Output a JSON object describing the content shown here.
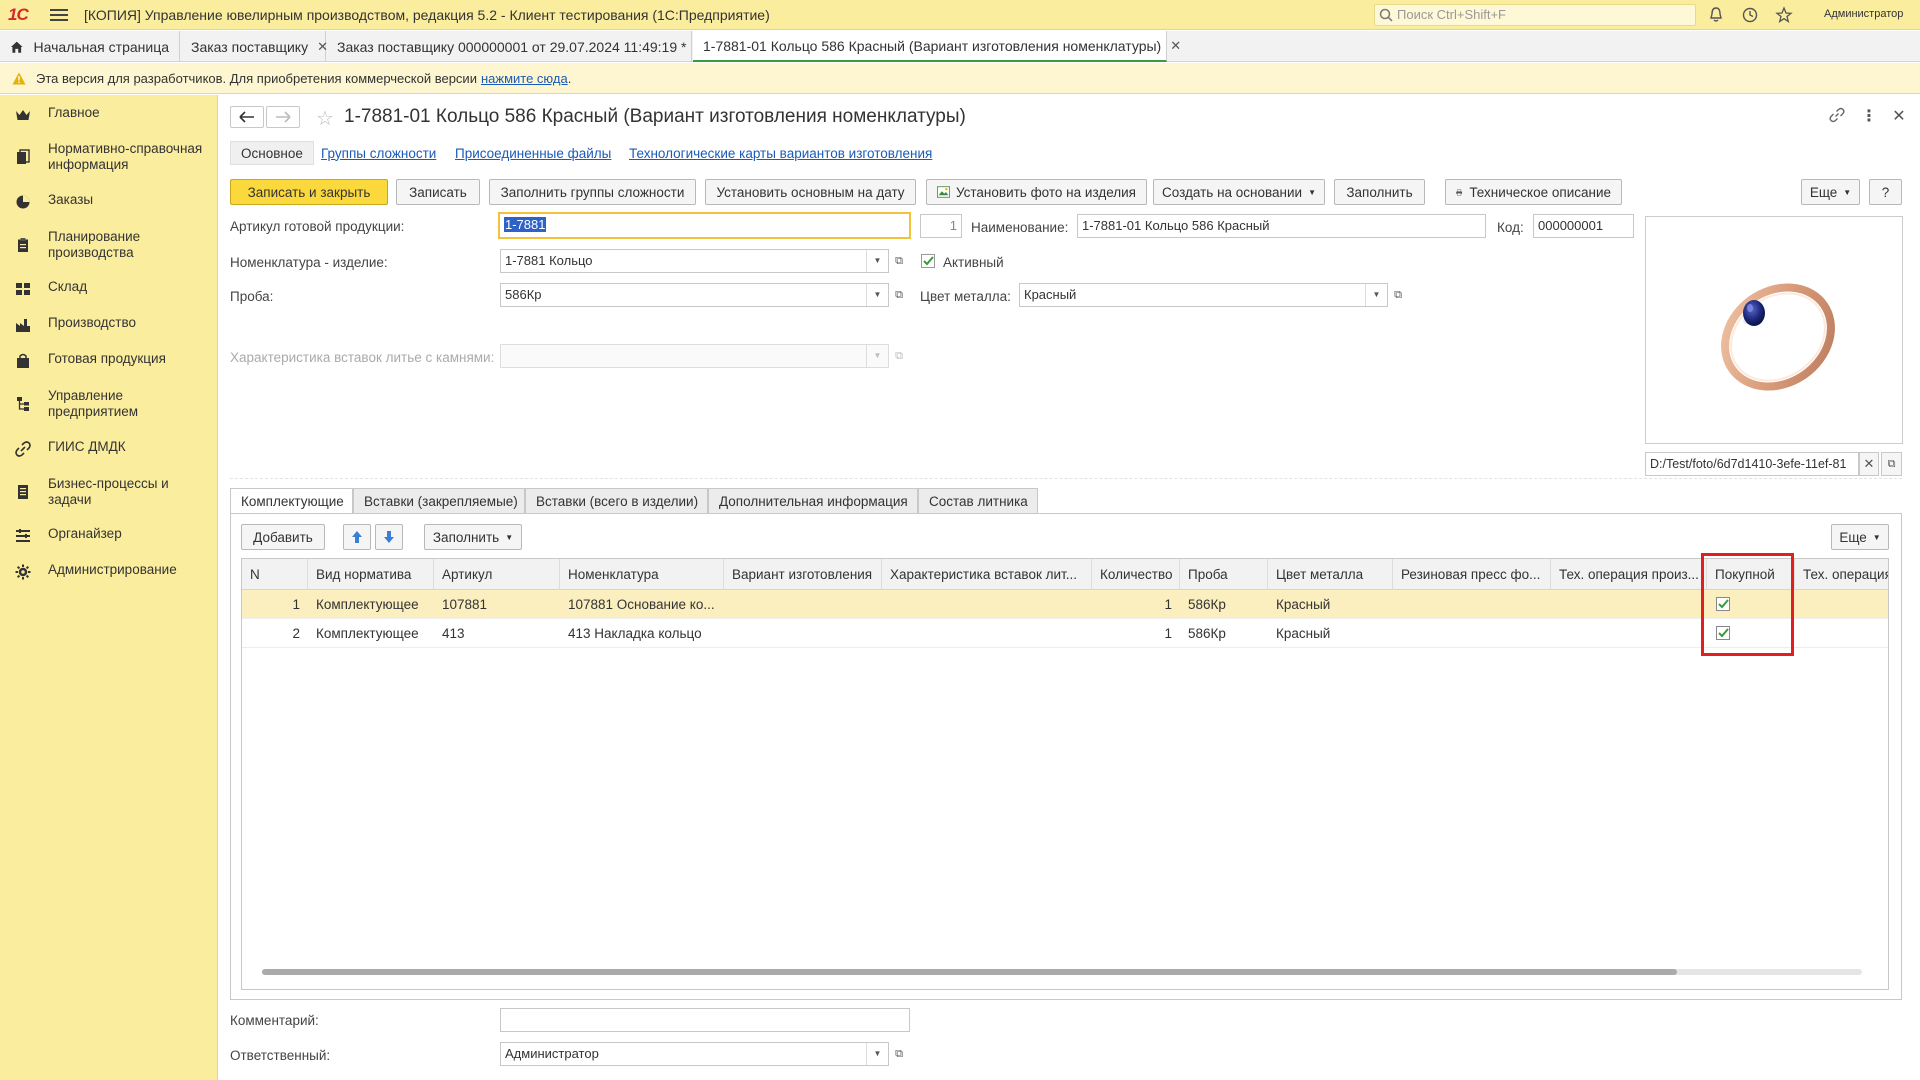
{
  "app": {
    "logo": "1С",
    "title": "[КОПИЯ] Управление ювелирным производством, редакция 5.2  - Клиент тестирования (1С:Предприятие)",
    "search_placeholder": "Поиск Ctrl+Shift+F",
    "user": "Администратор"
  },
  "tabs": [
    {
      "label": "Начальная страница"
    },
    {
      "label": "Заказ поставщику"
    },
    {
      "label": "Заказ поставщику 000000001 от 29.07.2024 11:49:19 *"
    },
    {
      "label": "1-7881-01 Кольцо 586 Красный (Вариант изготовления номенклатуры)"
    }
  ],
  "notice": {
    "text": "Эта версия для разработчиков. Для приобретения коммерческой версии",
    "link": "нажмите сюда",
    "tail": "."
  },
  "sidebar": {
    "items": [
      {
        "label": "Главное",
        "icon": "crown-icon"
      },
      {
        "label": "Нормативно-справочная информация",
        "icon": "book-icon"
      },
      {
        "label": "Заказы",
        "icon": "chart-icon"
      },
      {
        "label": "Планирование производства",
        "icon": "clipboard-icon"
      },
      {
        "label": "Склад",
        "icon": "grid-icon"
      },
      {
        "label": "Производство",
        "icon": "factory-icon"
      },
      {
        "label": "Готовая продукция",
        "icon": "bag-icon"
      },
      {
        "label": "Управление предприятием",
        "icon": "org-icon"
      },
      {
        "label": "ГИИС ДМДК",
        "icon": "link-icon"
      },
      {
        "label": "Бизнес-процессы и задачи",
        "icon": "tasks-icon"
      },
      {
        "label": "Органайзер",
        "icon": "list-icon"
      },
      {
        "label": "Администрирование",
        "icon": "gear-icon"
      }
    ]
  },
  "form": {
    "title": "1-7881-01 Кольцо 586 Красный (Вариант изготовления номенклатуры)",
    "subtabs": {
      "main": "Основное",
      "complexity": "Группы сложности",
      "files": "Присоединенные файлы",
      "techcards": "Технологические карты вариантов изготовления"
    },
    "buttons": {
      "save_close": "Записать и закрыть",
      "save": "Записать",
      "fill_groups": "Заполнить группы сложности",
      "set_main": "Установить основным на дату",
      "set_photo": "Установить фото на изделия",
      "create_based": "Создать на основании",
      "fill": "Заполнить",
      "tech_desc": "Техническое описание",
      "more": "Еще",
      "help": "?"
    },
    "fields": {
      "article_label": "Артикул готовой продукции:",
      "article_value": "1-7881",
      "seq_value": "1",
      "name_label": "Наименование:",
      "name_value": "1-7881-01 Кольцо 586 Красный",
      "code_label": "Код:",
      "code_value": "000000001",
      "nomenclature_label": "Номенклатура - изделие:",
      "nomenclature_value": "1-7881 Кольцо",
      "active_label": "Активный",
      "assay_label": "Проба:",
      "assay_value": "586Кр",
      "metal_color_label": "Цвет металла:",
      "metal_color_value": "Красный",
      "inserts_label": "Характеристика вставок литье с камнями:",
      "photo_path": "D:/Test/foto/6d7d1410-3efe-11ef-81"
    },
    "inner_tabs": [
      "Комплектующие",
      "Вставки (закрепляемые)",
      "Вставки (всего в изделии)",
      "Дополнительная информация",
      "Состав литника"
    ],
    "grid_toolbar": {
      "add": "Добавить",
      "fill": "Заполнить",
      "more": "Еще"
    },
    "grid": {
      "columns": [
        "N",
        "Вид норматива",
        "Артикул",
        "Номенклатура",
        "Вариант изготовления",
        "Характеристика вставок лит...",
        "Количество",
        "Проба",
        "Цвет металла",
        "Резиновая пресс фо...",
        "Тех. операция произ...",
        "Покупной",
        "Тех. операция "
      ],
      "rows": [
        {
          "n": "1",
          "kind": "Комплектующее",
          "article": "107881",
          "nomenclature": "107881 Основание ко...",
          "variant": "",
          "inserts": "",
          "qty": "1",
          "assay": "586Кр",
          "color": "Красный",
          "press": "",
          "techop": "",
          "purchased": true
        },
        {
          "n": "2",
          "kind": "Комплектующее",
          "article": "413",
          "nomenclature": "413 Накладка кольцо",
          "variant": "",
          "inserts": "",
          "qty": "1",
          "assay": "586Кр",
          "color": "Красный",
          "press": "",
          "techop": "",
          "purchased": true
        }
      ]
    },
    "footer": {
      "comment_label": "Комментарий:",
      "comment_value": "",
      "responsible_label": "Ответственный:",
      "responsible_value": "Администратор"
    }
  },
  "colors": {
    "sidebar_bg": "#fbed9e",
    "primary_button": "#fbd93c",
    "link": "#1a5ab8",
    "highlight": "#e02020",
    "check": "#3b9a3b"
  }
}
